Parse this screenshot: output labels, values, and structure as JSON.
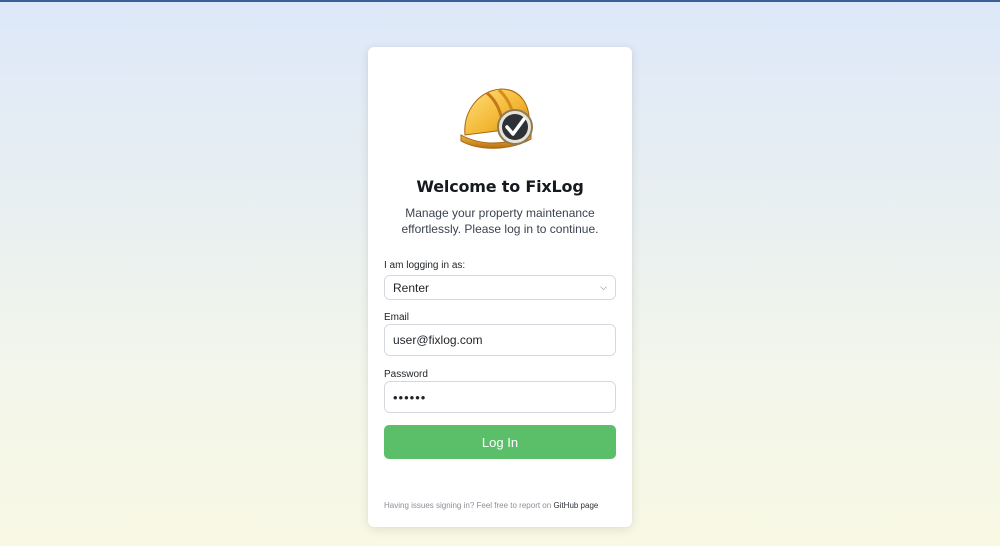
{
  "login": {
    "title": "Welcome to FixLog",
    "subtitle": "Manage your property maintenance effortlessly. Please log in to continue.",
    "role_label": "I am logging in as:",
    "role_value": "Renter",
    "email_label": "Email",
    "email_value": "user@fixlog.com",
    "password_label": "Password",
    "password_value": "••••••",
    "button_label": "Log In",
    "footer_text": "Having issues signing in? Feel free to report on",
    "footer_link": "GitHub page"
  },
  "icons": {
    "logo": "hard-hat-checkmark-icon",
    "select_chevron": "chevron-down-icon"
  },
  "colors": {
    "button": "#5bbf6a",
    "top_line": "#3a5f98"
  }
}
